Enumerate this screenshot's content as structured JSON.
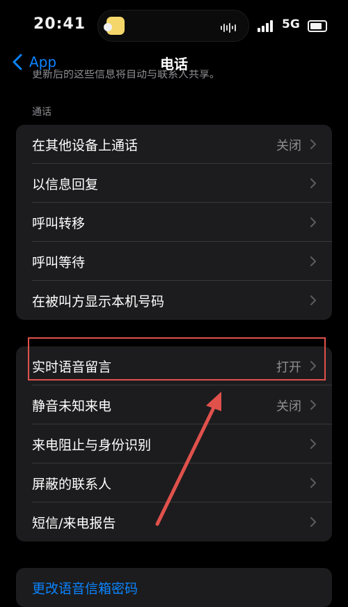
{
  "status_bar": {
    "time": "20:41",
    "network": "5G"
  },
  "nav": {
    "back_label": "App",
    "title": "电话"
  },
  "cut_note": "更新后的这些信息将自动与联系人共享。",
  "section_header": "通话",
  "group1": [
    {
      "label": "在其他设备上通话",
      "value": "关闭"
    },
    {
      "label": "以信息回复",
      "value": ""
    },
    {
      "label": "呼叫转移",
      "value": ""
    },
    {
      "label": "呼叫等待",
      "value": ""
    },
    {
      "label": "在被叫方显示本机号码",
      "value": ""
    }
  ],
  "group2": [
    {
      "label": "实时语音留言",
      "value": "打开"
    },
    {
      "label": "静音未知来电",
      "value": "关闭"
    },
    {
      "label": "来电阻止与身份识别",
      "value": ""
    },
    {
      "label": "屏蔽的联系人",
      "value": ""
    },
    {
      "label": "短信/来电报告",
      "value": ""
    }
  ],
  "group3": [
    {
      "label": "更改语音信箱密码"
    }
  ],
  "colors": {
    "accent": "#0a84ff",
    "annotation": "#e0514c",
    "cell_bg": "#1c1c1e"
  }
}
